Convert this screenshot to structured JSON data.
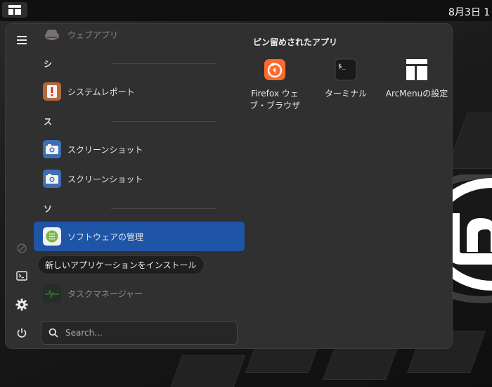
{
  "topbar": {
    "clock": "8月3日  1"
  },
  "menu": {
    "app_list": [
      {
        "name": "web-apps",
        "label": "ウェブアプリ",
        "faded": true
      },
      {
        "name": "system-report",
        "label": "システムレポート"
      },
      {
        "name": "screenshot-1",
        "label": "スクリーンショット"
      },
      {
        "name": "screenshot-2",
        "label": "スクリーンショット"
      },
      {
        "name": "software-manager",
        "label": "ソフトウェアの管理",
        "selected": true
      },
      {
        "name": "task-manager",
        "label": "タスクマネージャー",
        "faded": true
      }
    ],
    "headers": [
      "シ",
      "ス",
      "ソ"
    ],
    "tooltip": "新しいアプリケーションをインストール",
    "search_placeholder": "Search..."
  },
  "pinned": {
    "title": "ピン留めされたアプリ",
    "apps": [
      {
        "label": "Firefox ウェブ・ブラウザ",
        "icon": "firefox-icon"
      },
      {
        "label": "ターミナル",
        "icon": "terminal-icon"
      },
      {
        "label": "ArcMenuの設定",
        "icon": "arcmenu-settings-icon"
      }
    ]
  },
  "colors": {
    "selected": "#1f55a6",
    "panel": "#303030",
    "firefox": "#ff6a2a"
  }
}
